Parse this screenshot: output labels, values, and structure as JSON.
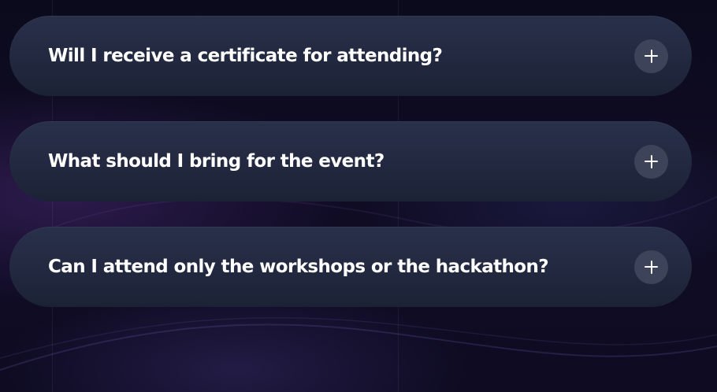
{
  "faq": {
    "items": [
      {
        "question": "Will I receive a certificate for attending?",
        "icon": "plus-icon",
        "expanded": false
      },
      {
        "question": "What should I bring for the event?",
        "icon": "plus-icon",
        "expanded": false
      },
      {
        "question": "Can I attend only the workshops or the hackathon?",
        "icon": "plus-icon",
        "expanded": false
      }
    ]
  },
  "theme": {
    "card_color": "#232a40",
    "toggle_color": "#3d4459",
    "text_color": "#ffffff",
    "background_color": "#0e0b22"
  }
}
